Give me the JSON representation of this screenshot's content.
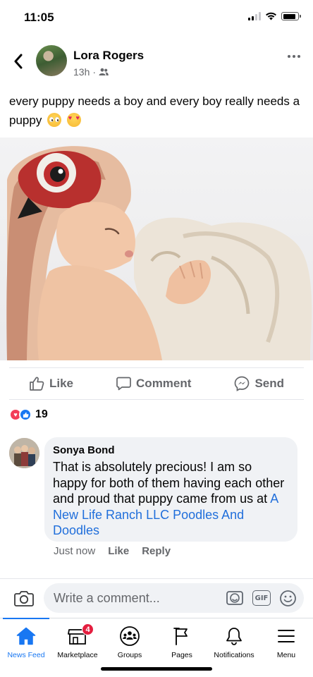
{
  "status_bar": {
    "time": "11:05",
    "icons": [
      "cellular-signal-icon",
      "wifi-icon",
      "battery-icon"
    ]
  },
  "post": {
    "author": "Lora Rogers",
    "time_ago": "13h",
    "meta_separator": "·",
    "privacy_icon": "friends-icon",
    "text": "every puppy needs a boy and every boy really needs a puppy",
    "emojis": [
      "pleading-face-emoji",
      "heart-eyes-emoji"
    ],
    "photo_icon": "photo-boy-kissing-puppy"
  },
  "actions": {
    "like": "Like",
    "comment": "Comment",
    "send": "Send"
  },
  "reactions": {
    "types": [
      "love",
      "like"
    ],
    "count": "19"
  },
  "comment": {
    "author": "Sonya Bond",
    "text": "That is absolutely precious! I am so happy for both of them having each other and proud that puppy came from us at ",
    "link": "A New Life Ranch LLC Poodles And Doodles",
    "time": "Just now",
    "like": "Like",
    "reply": "Reply"
  },
  "composer": {
    "placeholder": "Write a comment...",
    "gif_label": "GIF"
  },
  "tabs": [
    {
      "label": "News Feed",
      "icon": "home-icon",
      "active": true
    },
    {
      "label": "Marketplace",
      "icon": "marketplace-icon",
      "badge": "4"
    },
    {
      "label": "Groups",
      "icon": "groups-icon"
    },
    {
      "label": "Pages",
      "icon": "pages-flag-icon"
    },
    {
      "label": "Notifications",
      "icon": "bell-icon"
    },
    {
      "label": "Menu",
      "icon": "hamburger-menu-icon"
    }
  ],
  "colors": {
    "accent": "#1877f2",
    "link": "#216fdb",
    "secondary_text": "#65676b",
    "bubble": "#f0f2f5",
    "badge": "#e41e3f",
    "love": "#f33e58"
  }
}
